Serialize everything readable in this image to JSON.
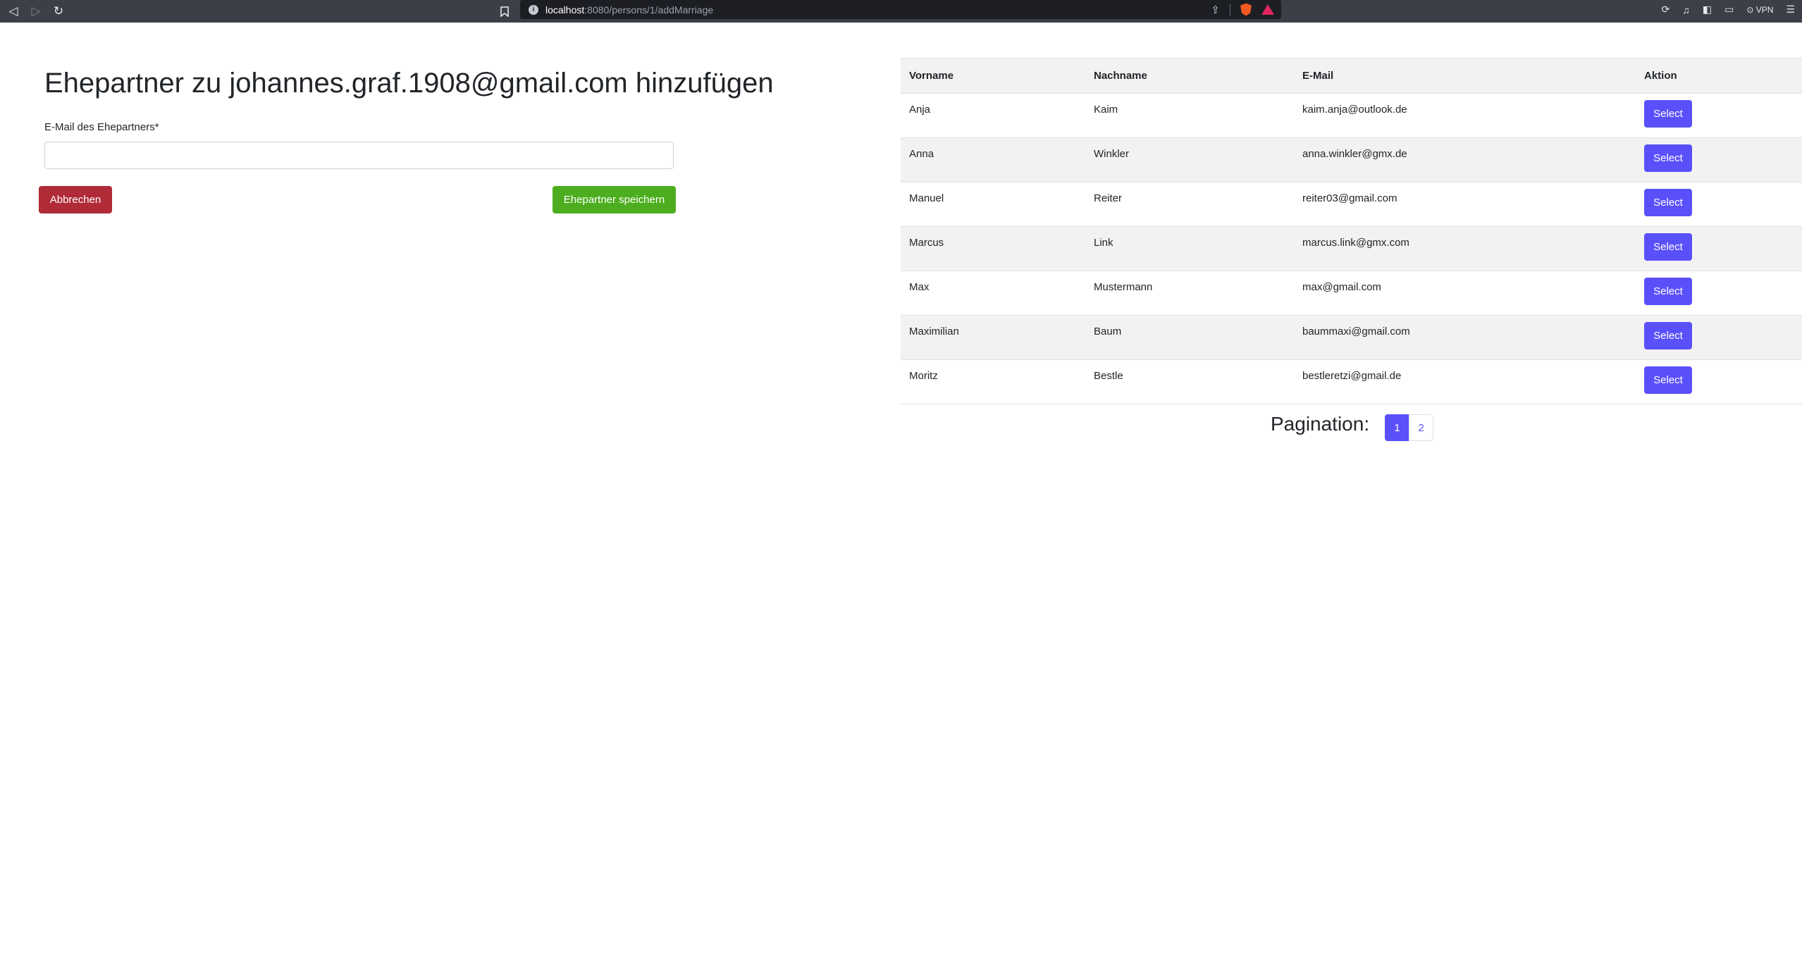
{
  "browser": {
    "url_host": "localhost",
    "url_path": ":8080/persons/1/addMarriage",
    "vpn_label": "VPN"
  },
  "form": {
    "title": "Ehepartner zu johannes.graf.1908@gmail.com hinzufügen",
    "email_label": "E-Mail des Ehepartners*",
    "email_value": "",
    "cancel_label": "Abbrechen",
    "save_label": "Ehepartner speichern"
  },
  "table": {
    "headers": {
      "first_name": "Vorname",
      "last_name": "Nachname",
      "email": "E-Mail",
      "action": "Aktion"
    },
    "rows": [
      {
        "first_name": "Anja",
        "last_name": "Kaim",
        "email": "kaim.anja@outlook.de",
        "action": "Select"
      },
      {
        "first_name": "Anna",
        "last_name": "Winkler",
        "email": "anna.winkler@gmx.de",
        "action": "Select"
      },
      {
        "first_name": "Manuel",
        "last_name": "Reiter",
        "email": "reiter03@gmail.com",
        "action": "Select"
      },
      {
        "first_name": "Marcus",
        "last_name": "Link",
        "email": "marcus.link@gmx.com",
        "action": "Select"
      },
      {
        "first_name": "Max",
        "last_name": "Mustermann",
        "email": "max@gmail.com",
        "action": "Select"
      },
      {
        "first_name": "Maximilian",
        "last_name": "Baum",
        "email": "baummaxi@gmail.com",
        "action": "Select"
      },
      {
        "first_name": "Moritz",
        "last_name": "Bestle",
        "email": "bestleretzi@gmail.de",
        "action": "Select"
      }
    ]
  },
  "pagination": {
    "label": "Pagination:",
    "pages": [
      "1",
      "2"
    ],
    "active_page": "1"
  },
  "colors": {
    "cancel": "#b02a37",
    "save": "#4cae1f",
    "select": "#5a50fa",
    "row_stripe": "#f2f2f2"
  }
}
